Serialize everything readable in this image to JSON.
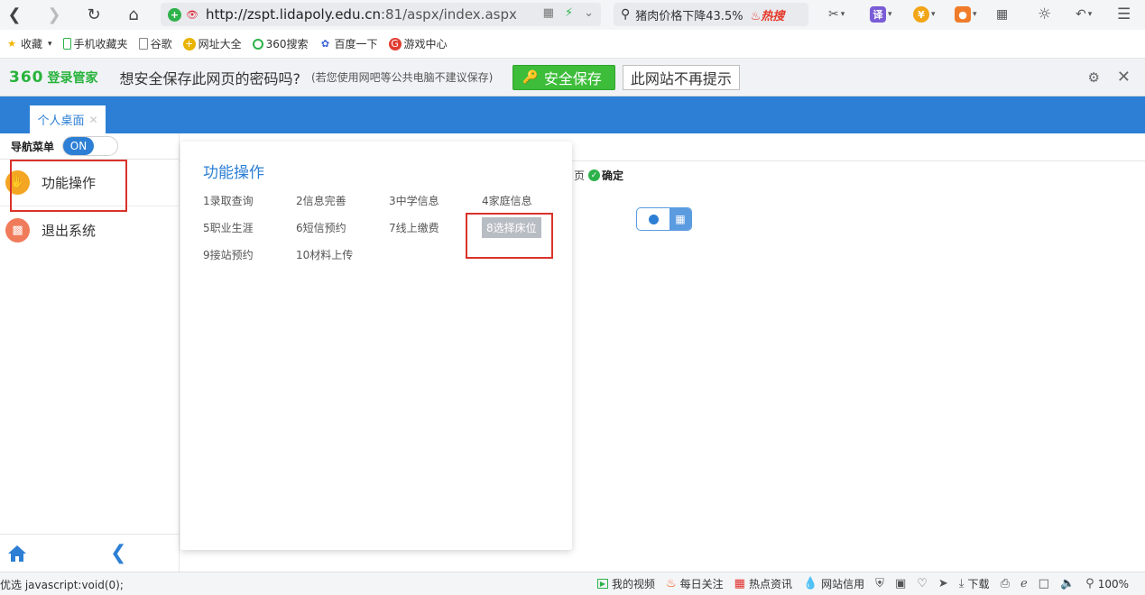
{
  "browser": {
    "url_host": "http://zspt.lidapoly.edu.cn",
    "url_rest": ":81/aspx/index.aspx",
    "search_text": "猪肉价格下降43.5%",
    "search_hot": "热搜"
  },
  "bookmarks": [
    {
      "label": "收藏",
      "icon": "star-icon"
    },
    {
      "label": "手机收藏夹",
      "icon": "phone-icon"
    },
    {
      "label": "谷歌",
      "icon": "page-icon"
    },
    {
      "label": "网址大全",
      "icon": "globe-icon"
    },
    {
      "label": "360搜索",
      "icon": "search-360-icon"
    },
    {
      "label": "百度一下",
      "icon": "baidu-icon"
    },
    {
      "label": "游戏中心",
      "icon": "game-icon"
    }
  ],
  "password_bar": {
    "logo": "360",
    "logo_sub": "登录管家",
    "question": "想安全保存此网页的密码吗?",
    "note": "(若您使用网吧等公共电脑不建议保存)",
    "save_label": "安全保存",
    "no_prompt_label": "此网站不再提示"
  },
  "app": {
    "tab_label": "个人桌面",
    "nav_label": "导航菜单",
    "nav_switch": "ON",
    "menu": [
      {
        "label": "功能操作",
        "icon": "gear-hand-icon"
      },
      {
        "label": "退出系统",
        "icon": "chart-icon"
      }
    ],
    "behind": {
      "page_fragment": "页",
      "confirm": "确定"
    }
  },
  "panel": {
    "title": "功能操作",
    "functions": [
      "1录取查询",
      "2信息完善",
      "3中学信息",
      "4家庭信息",
      "5职业生涯",
      "6短信预约",
      "7线上缴费",
      "8选择床位",
      "9接站预约",
      "10材料上传"
    ],
    "active_index": 7
  },
  "statusbar": {
    "left": "优选   javascript:void(0);",
    "items": [
      "我的视频",
      "每日关注",
      "热点资讯",
      "网站信用"
    ],
    "download": "下载",
    "zoom": "100%"
  },
  "colors": {
    "app_blue": "#2c7fd4",
    "save_green": "#3dbd3a",
    "highlight_red": "#d9332a"
  }
}
